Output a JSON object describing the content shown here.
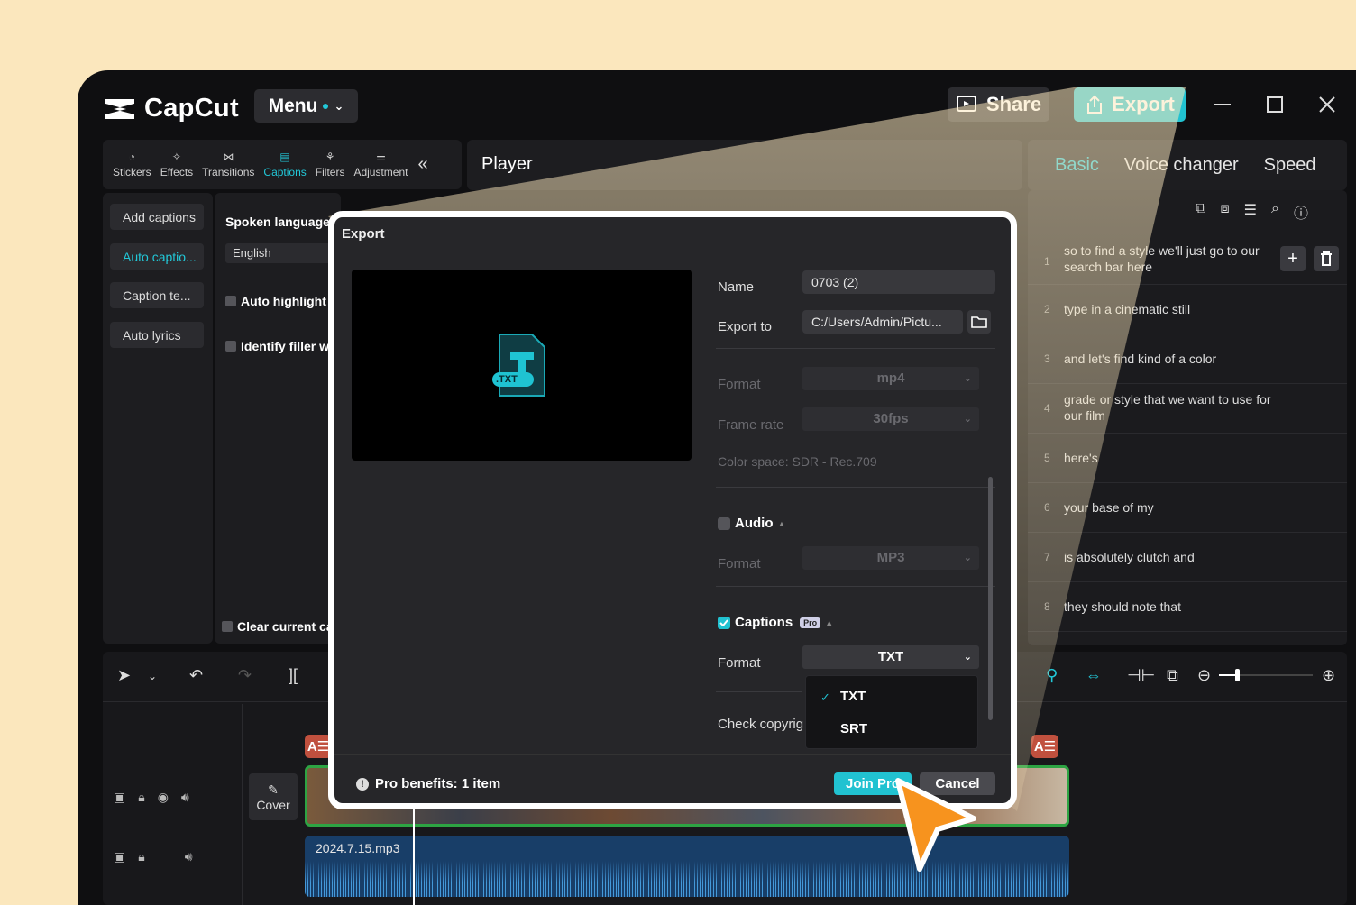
{
  "app": {
    "name": "CapCut",
    "menu_label": "Menu",
    "share_label": "Share",
    "export_label": "Export"
  },
  "toolbar": {
    "tools": [
      {
        "label": "Stickers",
        "icon": "stickers-icon"
      },
      {
        "label": "Effects",
        "icon": "effects-icon"
      },
      {
        "label": "Transitions",
        "icon": "transitions-icon"
      },
      {
        "label": "Captions",
        "icon": "captions-icon",
        "active": true
      },
      {
        "label": "Filters",
        "icon": "filters-icon"
      },
      {
        "label": "Adjustment",
        "icon": "adjustment-icon"
      }
    ]
  },
  "left_sidebar": {
    "items": [
      "Add captions",
      "Auto captio...",
      "Caption te...",
      "Auto lyrics"
    ]
  },
  "caption_settings": {
    "spoken_language_label": "Spoken language",
    "language_value": "English",
    "auto_highlight": "Auto highlight",
    "identify_filler": "Identify filler w",
    "clear_current": "Clear current ca"
  },
  "player": {
    "title": "Player"
  },
  "right_panel": {
    "tabs": [
      "Basic",
      "Voice changer",
      "Speed"
    ],
    "captions": [
      {
        "num": "1",
        "text": "so to find a style we'll just go to our search bar here"
      },
      {
        "num": "2",
        "text": "type in a cinematic still"
      },
      {
        "num": "3",
        "text": "and let's find kind of a color"
      },
      {
        "num": "4",
        "text": "grade or style that we want to use for our film"
      },
      {
        "num": "5",
        "text": "here's"
      },
      {
        "num": "6",
        "text": "your base of my"
      },
      {
        "num": "7",
        "text": "is absolutely clutch and"
      },
      {
        "num": "8",
        "text": "they should note that"
      }
    ]
  },
  "timeline": {
    "cover_label": "Cover",
    "audio_clip_name": "2024.7.15.mp3",
    "caption_badge": "A☰"
  },
  "export_dialog": {
    "title": "Export",
    "preview_badge": ".TXT",
    "name_label": "Name",
    "name_value": "0703 (2)",
    "export_to_label": "Export to",
    "export_to_value": "C:/Users/Admin/Pictu...",
    "video_format_label": "Format",
    "video_format_value": "mp4",
    "frame_rate_label": "Frame rate",
    "frame_rate_value": "30fps",
    "color_space": "Color space: SDR - Rec.709",
    "audio_label": "Audio",
    "audio_format_label": "Format",
    "audio_format_value": "MP3",
    "captions_label": "Captions",
    "pro_badge": "Pro",
    "captions_format_label": "Format",
    "captions_format_value": "TXT",
    "caption_format_options": [
      "TXT",
      "SRT"
    ],
    "check_copyright": "Check copyrig",
    "pro_benefits": "Pro benefits: 1 item",
    "join_pro": "Join Pro",
    "cancel": "Cancel"
  },
  "colors": {
    "accent": "#21c2d1",
    "background_frame": "#fbe7bd",
    "cursor": "#f7931e"
  }
}
